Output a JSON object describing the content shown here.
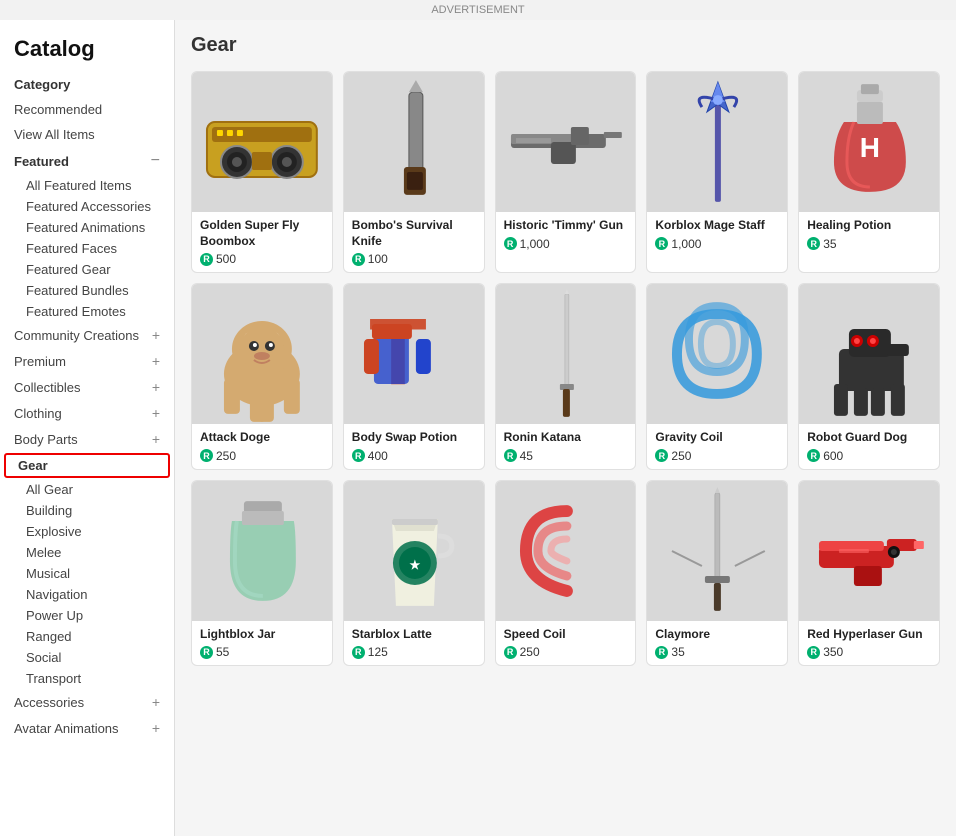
{
  "page": {
    "title": "Catalog",
    "ad_label": "ADVERTISEMENT"
  },
  "sidebar": {
    "category_label": "Category",
    "top_items": [
      {
        "id": "recommended",
        "label": "Recommended"
      },
      {
        "id": "view-all",
        "label": "View All Items"
      }
    ],
    "featured": {
      "label": "Featured",
      "toggle": "−",
      "sub_items": [
        {
          "id": "all-featured",
          "label": "All Featured Items"
        },
        {
          "id": "featured-accessories",
          "label": "Featured Accessories"
        },
        {
          "id": "featured-animations",
          "label": "Featured Animations"
        },
        {
          "id": "featured-faces",
          "label": "Featured Faces"
        },
        {
          "id": "featured-gear",
          "label": "Featured Gear"
        },
        {
          "id": "featured-bundles",
          "label": "Featured Bundles"
        },
        {
          "id": "featured-emotes",
          "label": "Featured Emotes"
        }
      ]
    },
    "community_creations": {
      "label": "Community Creations",
      "toggle": "+"
    },
    "categories": [
      {
        "id": "premium",
        "label": "Premium",
        "toggle": "+"
      },
      {
        "id": "collectibles",
        "label": "Collectibles",
        "toggle": "+"
      },
      {
        "id": "clothing",
        "label": "Clothing",
        "toggle": "+"
      },
      {
        "id": "body-parts",
        "label": "Body Parts",
        "toggle": "+"
      }
    ],
    "gear": {
      "label": "Gear",
      "active": true,
      "sub_items": [
        {
          "id": "all-gear",
          "label": "All Gear"
        },
        {
          "id": "building",
          "label": "Building"
        },
        {
          "id": "explosive",
          "label": "Explosive"
        },
        {
          "id": "melee",
          "label": "Melee"
        },
        {
          "id": "musical",
          "label": "Musical"
        },
        {
          "id": "navigation",
          "label": "Navigation"
        },
        {
          "id": "power-up",
          "label": "Power Up"
        },
        {
          "id": "ranged",
          "label": "Ranged"
        },
        {
          "id": "social",
          "label": "Social"
        },
        {
          "id": "transport",
          "label": "Transport"
        }
      ]
    },
    "bottom_categories": [
      {
        "id": "accessories",
        "label": "Accessories",
        "toggle": "+"
      },
      {
        "id": "avatar-animations",
        "label": "Avatar Animations",
        "toggle": "+"
      }
    ]
  },
  "content": {
    "section_title": "Gear",
    "items": [
      {
        "id": "golden-boombox",
        "name": "Golden Super Fly Boombox",
        "price": "500",
        "color": "#c8b080",
        "shape": "boombox"
      },
      {
        "id": "bombo-knife",
        "name": "Bombo's Survival Knife",
        "price": "100",
        "color": "#555",
        "shape": "knife"
      },
      {
        "id": "timmy-gun",
        "name": "Historic 'Timmy' Gun",
        "price": "1,000",
        "color": "#888",
        "shape": "rifle"
      },
      {
        "id": "korblox-staff",
        "name": "Korblox Mage Staff",
        "price": "1,000",
        "color": "#4466aa",
        "shape": "staff"
      },
      {
        "id": "healing-potion",
        "name": "Healing Potion",
        "price": "35",
        "color": "#cc3333",
        "shape": "potion"
      },
      {
        "id": "attack-doge",
        "name": "Attack Doge",
        "price": "250",
        "color": "#d4aa70",
        "shape": "doge"
      },
      {
        "id": "body-swap",
        "name": "Body Swap Potion",
        "price": "400",
        "color": "#cc4422",
        "shape": "swap"
      },
      {
        "id": "ronin-katana",
        "name": "Ronin Katana",
        "price": "45",
        "color": "#aaa",
        "shape": "katana"
      },
      {
        "id": "gravity-coil",
        "name": "Gravity Coil",
        "price": "250",
        "color": "#3399dd",
        "shape": "coil"
      },
      {
        "id": "robot-dog",
        "name": "Robot Guard Dog",
        "price": "600",
        "color": "#333",
        "shape": "robot-dog"
      },
      {
        "id": "lightblox-jar",
        "name": "Lightblox Jar",
        "price": "55",
        "color": "#88ccaa",
        "shape": "jar"
      },
      {
        "id": "starblox-latte",
        "name": "Starblox Latte",
        "price": "125",
        "color": "#ddddcc",
        "shape": "cup"
      },
      {
        "id": "speed-coil",
        "name": "Speed Coil",
        "price": "250",
        "color": "#dd4444",
        "shape": "speed-coil"
      },
      {
        "id": "claymore",
        "name": "Claymore",
        "price": "35",
        "color": "#999",
        "shape": "claymore"
      },
      {
        "id": "red-hyperlaser",
        "name": "Red Hyperlaser Gun",
        "price": "350",
        "color": "#cc2222",
        "shape": "laser-gun"
      }
    ]
  }
}
